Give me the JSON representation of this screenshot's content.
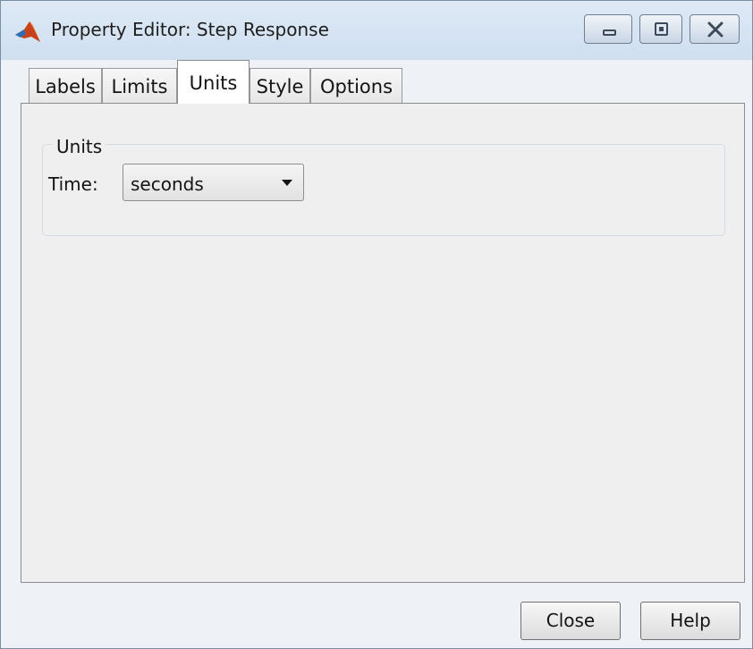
{
  "window": {
    "title": "Property Editor: Step Response",
    "app_icon": "matlab-logo-icon",
    "controls": [
      "minimize-icon",
      "maximize-icon",
      "close-icon"
    ]
  },
  "tabs": [
    {
      "label": "Labels",
      "active": false
    },
    {
      "label": "Limits",
      "active": false
    },
    {
      "label": "Units",
      "active": true
    },
    {
      "label": "Style",
      "active": false
    },
    {
      "label": "Options",
      "active": false
    }
  ],
  "units_group": {
    "title": "Units",
    "time_label": "Time:",
    "time_value": "seconds"
  },
  "buttons": {
    "close_label": "Close",
    "help_label": "Help"
  }
}
